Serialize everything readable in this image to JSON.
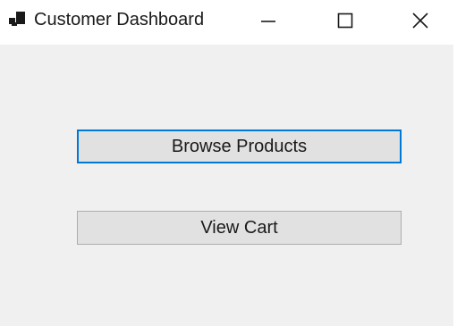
{
  "window": {
    "title": "Customer Dashboard",
    "icon": "app-window-icon"
  },
  "caption_buttons": {
    "minimize_icon": "minimize-icon",
    "maximize_icon": "maximize-icon",
    "close_icon": "close-icon"
  },
  "main": {
    "browse_products_label": "Browse Products",
    "view_cart_label": "View Cart"
  },
  "colors": {
    "focus_accent": "#0078d7",
    "client_background": "#f0f0f0",
    "button_face": "#e1e1e1",
    "button_border": "#adadad"
  }
}
